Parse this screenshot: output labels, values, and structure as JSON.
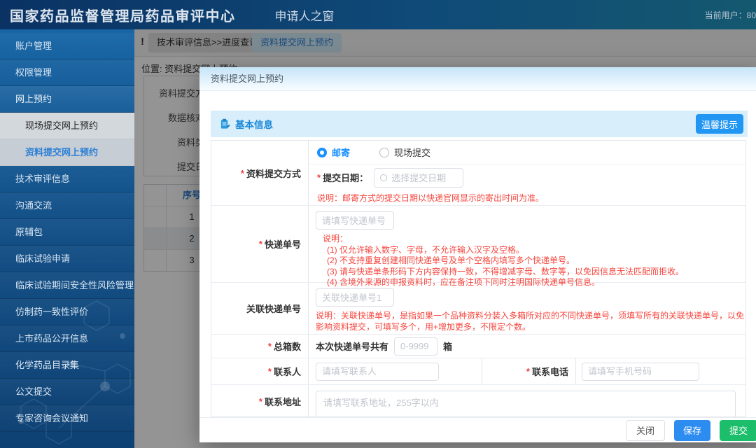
{
  "header": {
    "title": "国家药品监督管理局药品审评中心",
    "subtitle": "申请人之窗",
    "user_label": "当前用户：80"
  },
  "sidebar": {
    "items": [
      {
        "label": "账户管理"
      },
      {
        "label": "权限管理"
      },
      {
        "label": "网上预约"
      },
      {
        "label": "现场提交网上预约"
      },
      {
        "label": "资料提交网上预约"
      },
      {
        "label": "技术审评信息"
      },
      {
        "label": "沟通交流"
      },
      {
        "label": "原辅包"
      },
      {
        "label": "临床试验申请"
      },
      {
        "label": "临床试验期间安全性风险管理"
      },
      {
        "label": "仿制药一致性评价"
      },
      {
        "label": "上市药品公开信息"
      },
      {
        "label": "化学药品目录集"
      },
      {
        "label": "公文提交"
      },
      {
        "label": "专家咨询会议通知"
      }
    ]
  },
  "tabs": {
    "alert": "!",
    "items": [
      {
        "label": "技术审评信息>>进度查询"
      },
      {
        "label": "资料提交网上预约"
      }
    ]
  },
  "breadcrumb": "位置: 资料提交网上预约",
  "background": {
    "filter_labels": [
      "资料提交方",
      "数据核对",
      "资料类",
      "提交日"
    ],
    "table": {
      "header": "序号",
      "rows": [
        "1",
        "2",
        "3"
      ]
    }
  },
  "modal": {
    "title": "资料提交网上预约",
    "section_title": "基本信息",
    "tip_button": "温馨提示",
    "form": {
      "submit_method": {
        "label": "资料提交方式",
        "radio_mail": "邮寄",
        "radio_onsite": "现场提交",
        "date_label": "提交日期：",
        "date_placeholder": "选择提交日期",
        "note": "说明：邮寄方式的提交日期以快递官网显示的寄出时间为准。"
      },
      "express": {
        "label": "快递单号",
        "placeholder": "请填写快递单号",
        "notes": [
          "说明：",
          "(1) 仅允许输入数字、字母，不允许输入汉字及空格。",
          "(2) 不支持重复创建相同快递单号及单个空格内填写多个快递单号。",
          "(3) 请与快递单条形码下方内容保持一致，不得增减字母、数字等，以免因信息无法匹配而拒收。",
          "(4) 含境外来源的申报资料时，应在备注项下同时注明国际快递单号信息。"
        ]
      },
      "assoc": {
        "label": "关联快递单号",
        "placeholder": "关联快递单号1",
        "note": "说明：关联快递单号，是指如果一个品种资料分装入多箱所对应的不同快递单号，须填写所有的关联快递单号，以免影响资料提交，可填写多个，用+增加更多，不限定个数。"
      },
      "boxes": {
        "label": "总箱数",
        "prefix": "本次快递单号共有",
        "placeholder": "0-9999",
        "suffix": "箱"
      },
      "contact": {
        "label": "联系人",
        "placeholder": "请填写联系人"
      },
      "phone": {
        "label": "联系电话",
        "placeholder": "请填写手机号码"
      },
      "address": {
        "label": "联系地址",
        "placeholder": "请填写联系地址，255字以内"
      }
    },
    "footer": {
      "close": "关闭",
      "save": "保存",
      "submit": "提交"
    }
  },
  "colors": {
    "header_bg": "#0f4a78",
    "sidebar_bg": "#124e85",
    "accent_blue": "#2196f3",
    "active_text_blue": "#2a7fd5",
    "save_button": "#2d8cf0",
    "submit_button": "#1cbe6b",
    "note_red": "#f5453d",
    "section_bar_bg": "#d8eefb"
  }
}
